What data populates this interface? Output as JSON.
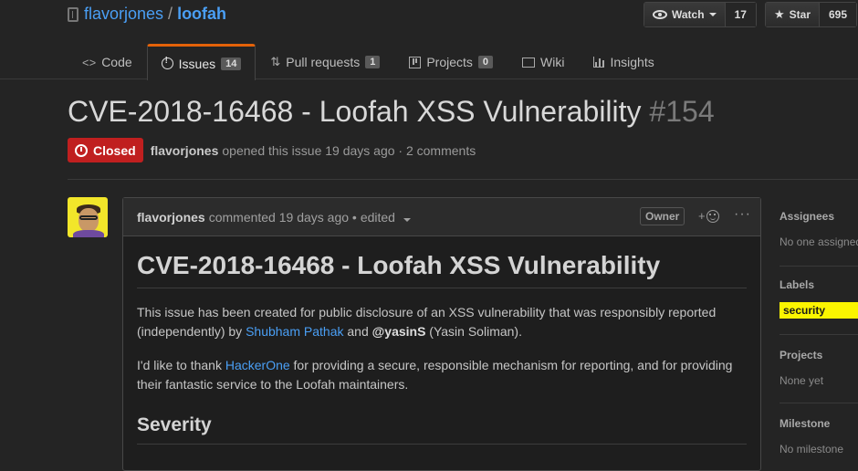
{
  "repo": {
    "owner": "flavorjones",
    "separator": "/",
    "name": "loofah"
  },
  "actions": {
    "watch_label": "Watch",
    "watch_count": "17",
    "star_label": "Star",
    "star_count": "695"
  },
  "tabs": [
    {
      "label": "Code",
      "icon": "code-icon"
    },
    {
      "label": "Issues",
      "icon": "issue-icon",
      "counter": "14",
      "selected": true
    },
    {
      "label": "Pull requests",
      "icon": "pull-request-icon",
      "counter": "1"
    },
    {
      "label": "Projects",
      "icon": "project-icon",
      "counter": "0"
    },
    {
      "label": "Wiki",
      "icon": "book-icon"
    },
    {
      "label": "Insights",
      "icon": "graph-icon"
    }
  ],
  "issue": {
    "title": "CVE-2018-16468 - Loofah XSS Vulnerability",
    "number": "#154",
    "state": "Closed",
    "author": "flavorjones",
    "meta_text": "opened this issue 19 days ago · 2 comments"
  },
  "comment": {
    "author": "flavorjones",
    "time_text": "commented 19 days ago •",
    "edited_label": "edited",
    "owner_badge": "Owner",
    "react_plus": "+",
    "more_label": "···",
    "heading": "CVE-2018-16468 - Loofah XSS Vulnerability",
    "p1_a": "This issue has been created for public disclosure of an XSS vulnerability that was responsibly reported (independently) by ",
    "p1_link": "Shubham Pathak",
    "p1_b": " and ",
    "p1_mention": "@yasinS",
    "p1_c": " (Yasin Soliman).",
    "p2_a": "I'd like to thank ",
    "p2_link": "HackerOne",
    "p2_b": " for providing a secure, responsible mechanism for reporting, and for providing their fantastic service to the Loofah maintainers.",
    "subheading": "Severity"
  },
  "sidebar": {
    "assignees_title": "Assignees",
    "assignees_value": "No one assigned",
    "labels_title": "Labels",
    "label_name": "security",
    "label_color": "#fbf500",
    "projects_title": "Projects",
    "projects_value": "None yet",
    "milestone_title": "Milestone",
    "milestone_value": "No milestone"
  },
  "colors": {
    "link": "#4a9ff5",
    "closed": "#c01f1f",
    "tab_accent": "#e36209"
  }
}
